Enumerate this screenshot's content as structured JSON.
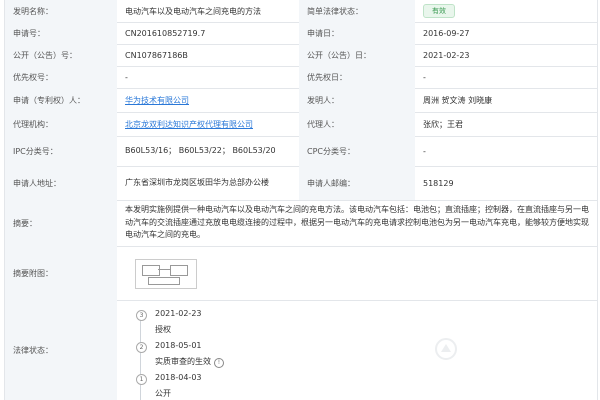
{
  "fields": {
    "title_label": "发明名称：",
    "title_value": "电动汽车以及电动汽车之间充电的方法",
    "status_label": "简单法律状态：",
    "status_value": "有效",
    "app_no_label": "申请号：",
    "app_no_value": "CN201610852719.7",
    "app_date_label": "申请日：",
    "app_date_value": "2016-09-27",
    "pub_no_label": "公开（公告）号：",
    "pub_no_value": "CN107867186B",
    "pub_date_label": "公开（公告）日：",
    "pub_date_value": "2021-02-23",
    "priority_no_label": "优先权号：",
    "priority_no_value": "-",
    "priority_date_label": "优先权日：",
    "priority_date_value": "-",
    "applicant_label": "申请（专利权）人：",
    "applicant_value": "华为技术有限公司",
    "inventor_label": "发明人：",
    "inventor_value": "周洲 贺文涛 刘晓康",
    "agency_label": "代理机构：",
    "agency_value": "北京龙双利达知识产权代理有限公司",
    "agent_label": "代理人：",
    "agent_value": "张欣；王君",
    "ipc_label": "IPC分类号：",
    "ipc_value": "B60L53/16； B60L53/22； B60L53/20",
    "cpc_label": "CPC分类号：",
    "cpc_value": "-",
    "address_label": "申请人地址：",
    "address_value": "广东省深圳市龙岗区坂田华为总部办公楼",
    "postcode_label": "申请人邮编：",
    "postcode_value": "518129",
    "abstract_label": "摘要：",
    "abstract_value": "本发明实施例提供一种电动汽车以及电动汽车之间的充电方法。该电动汽车包括：电池包；直流插座；控制器，在直流插座与另一电动汽车的交流插座通过充放电电缆连接的过程中，根据另一电动汽车的充电请求控制电池包为另一电动汽车充电，能够较方便地实现电动汽车之间的充电。",
    "figure_label": "摘要附图：",
    "legal_label": "法律状态："
  },
  "legal_events": [
    {
      "step": "3",
      "date": "2021-02-23",
      "name": "授权"
    },
    {
      "step": "2",
      "date": "2018-05-01",
      "name": "实质审查的生效"
    },
    {
      "step": "1",
      "date": "2018-04-03",
      "name": "公开"
    }
  ],
  "colors": {
    "link": "#2a78d8",
    "status_badge": "#3a9a52",
    "label_bg": "#f3f6f9"
  }
}
